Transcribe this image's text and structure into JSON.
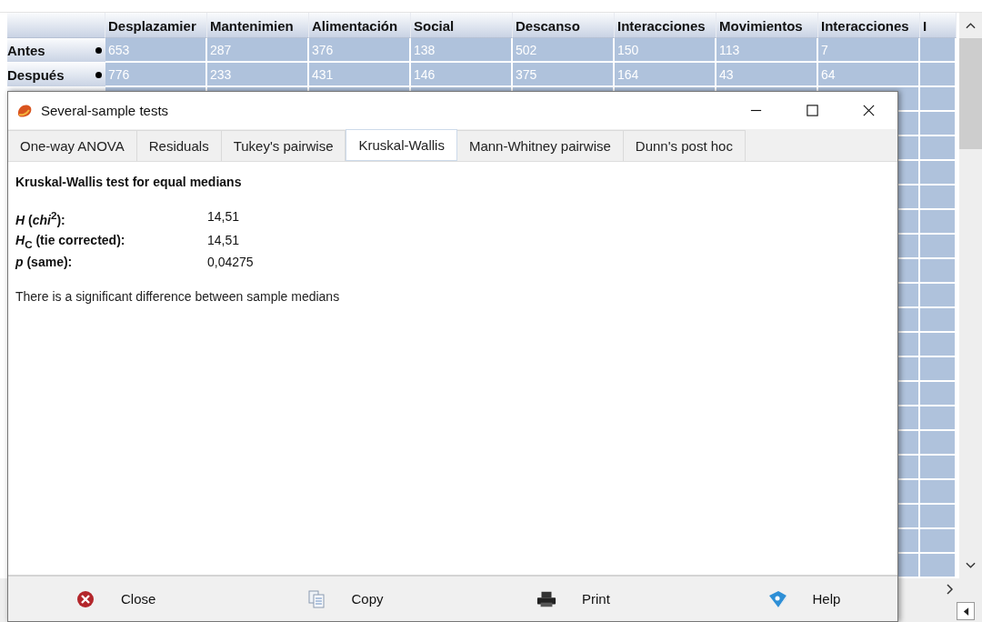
{
  "sheet": {
    "columns": [
      "Desplazamier",
      "Mantenimien",
      "Alimentación",
      "Social",
      "Descanso",
      "Interacciones",
      "Movimientos",
      "Interacciones",
      "I"
    ],
    "rows": [
      {
        "label": "Antes",
        "selected": true,
        "values": [
          "653",
          "287",
          "376",
          "138",
          "502",
          "150",
          "113",
          "7"
        ]
      },
      {
        "label": "Después",
        "selected": true,
        "values": [
          "776",
          "233",
          "431",
          "146",
          "375",
          "164",
          "43",
          "64"
        ]
      }
    ]
  },
  "dialog": {
    "title": "Several-sample tests",
    "tabs": [
      {
        "label": "One-way ANOVA",
        "selected": false
      },
      {
        "label": "Residuals",
        "selected": false
      },
      {
        "label": "Tukey's pairwise",
        "selected": false
      },
      {
        "label": "Kruskal-Wallis",
        "selected": true
      },
      {
        "label": "Mann-Whitney pairwise",
        "selected": false
      },
      {
        "label": "Dunn's post hoc",
        "selected": false
      }
    ],
    "heading": "Kruskal-Wallis test for equal medians",
    "results": [
      {
        "label": "*H* (*chi*$^{2}$):",
        "value": "14,51"
      },
      {
        "label": "*H*$_{C}$ (tie corrected):",
        "value": "14,51"
      },
      {
        "label": "*p* (same):",
        "value": "0,04275"
      }
    ],
    "conclusion": "There is a significant difference between sample medians",
    "buttons": [
      {
        "kind": "close",
        "label": "Close"
      },
      {
        "kind": "copy",
        "label": "Copy"
      },
      {
        "kind": "print",
        "label": "Print"
      },
      {
        "kind": "help",
        "label": "Help"
      }
    ]
  }
}
